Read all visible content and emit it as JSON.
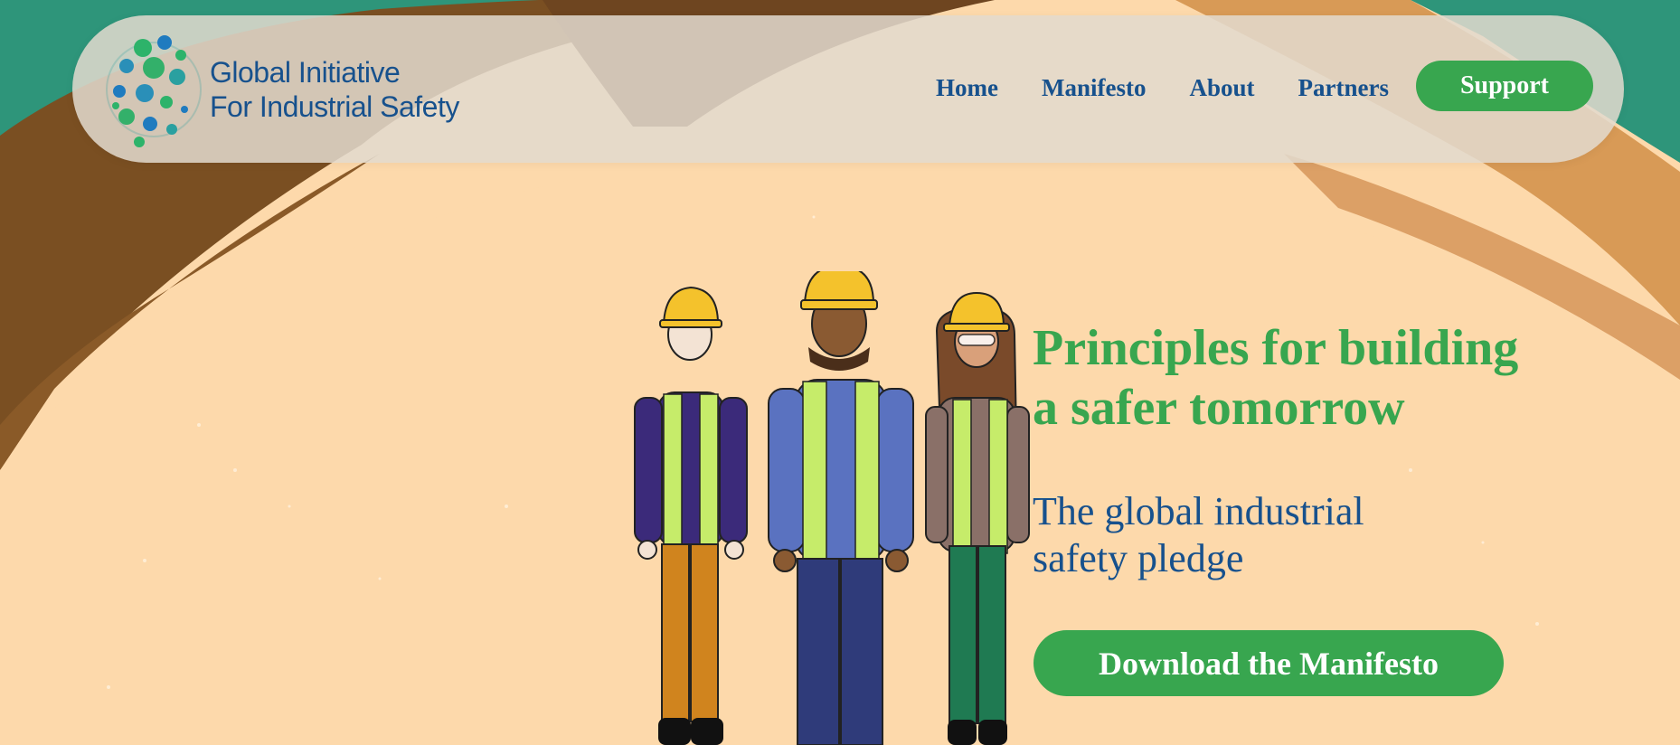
{
  "brand": {
    "logo_icon": "globe-dots-logo",
    "name_line1": "Global Initiative",
    "name_line2": "For Industrial Safety"
  },
  "nav": {
    "items": [
      {
        "label": "Home"
      },
      {
        "label": "Manifesto"
      },
      {
        "label": "About"
      },
      {
        "label": "Partners"
      }
    ],
    "support_label": "Support"
  },
  "hero": {
    "title_line1": "Principles for building",
    "title_line2": "a safer tomorrow",
    "subtitle_line1": "The global industrial",
    "subtitle_line2": "safety pledge",
    "cta_label": "Download the Manifesto",
    "illustration": "three-workers-hard-hats-illustration"
  },
  "colors": {
    "brand_green": "#38a64f",
    "brand_blue": "#17518d",
    "background_peach": "#fdd9ab",
    "teal": "#2e957a",
    "brown": "#7a4f22",
    "tan": "#d89a56"
  }
}
